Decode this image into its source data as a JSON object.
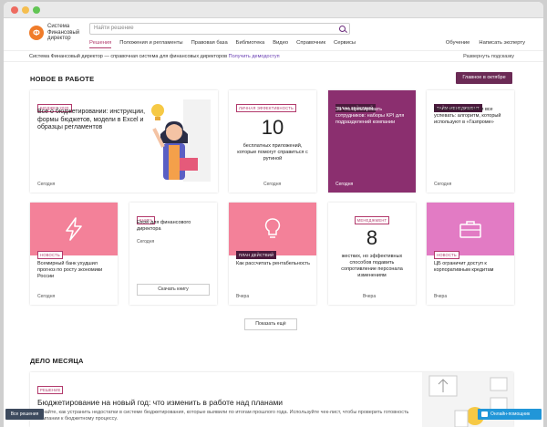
{
  "header": {
    "logo_mark": "Ф",
    "logo_text": "Система Финансовый директор",
    "search_placeholder": "Найти решение",
    "nav": [
      "Решения",
      "Положения и регламенты",
      "Правовая база",
      "Библиотека",
      "Видео",
      "Справочник",
      "Сервисы"
    ],
    "nav_right": [
      "Обучение",
      "Написать эксперту"
    ]
  },
  "subbar": {
    "text": "Система Финансовый директор — справочная система для финансовых директоров",
    "link": "Получить демодоступ",
    "hint": "Развернуть подсказку"
  },
  "section1": {
    "title": "НОВОЕ В РАБОТЕ",
    "main_button": "Главное в октябре"
  },
  "cards_row1": [
    {
      "tag": "БЮДЖЕТ 2020",
      "title": "Все о бюджетировании: инструкции, формы бюджетов, модели в Excel и образцы регламентов",
      "date": "Сегодня"
    },
    {
      "tag": "ЛИЧНАЯ ЭФФЕКТИВНОСТЬ",
      "number": "10",
      "title": "бесплатных приложений, которые помогут справиться с рутиной",
      "date": "Сегодня"
    },
    {
      "tag": "ПЛАН ДЕЙСТВИЙ",
      "title": "За что премировать сотрудников: наборы KPI для подразделений компании",
      "date": "Сегодня"
    },
    {
      "tag": "ТАЙМ-МЕНЕДЖМЕНТ",
      "title": "Как работать вполе и все успевать: алгоритм, который используют в «Газпроме»",
      "date": "Сегодня"
    }
  ],
  "cards_row2": [
    {
      "tag": "НОВОСТЬ",
      "title": "Всемирный банк ухудшил прогноз по росту экономики России",
      "date": "Сегодня"
    },
    {
      "tag": "КНИГА",
      "title": "Excel для финансового директора",
      "date": "Сегодня",
      "button": "Скачать книгу"
    },
    {
      "tag": "ПЛАН ДЕЙСТВИЙ",
      "title": "Как рассчитать рентабельность",
      "date": "Вчера"
    },
    {
      "tag": "МЕНЕДЖМЕНТ",
      "number": "8",
      "title": "жестких, но эффективных способов подавить сопротивление персонала изменениям",
      "date": "Вчера"
    },
    {
      "tag": "НОВОСТЬ",
      "title": "ЦБ ограничит доступ к корпоративным кредитам",
      "date": "Вчера"
    }
  ],
  "more_button": "Показать ещё",
  "section2": {
    "title": "ДЕЛО МЕСЯЦА",
    "tag": "РЕШЕНИЕ",
    "card_title": "Бюджетирование на новый год: что изменить в работе над планами",
    "card_desc": "Узнайте, как устранить недостатки в системе бюджетирования, которые выявили по итогам прошлого года. Используйте чек-лист, чтобы проверить готовность компании к бюджетному процессу."
  },
  "corner_button": "Все решения",
  "chat_button": "Онлайн-помощник",
  "colors": {
    "accent": "#b23a6c",
    "pink": "#f38199",
    "plum": "#8b2f6f",
    "lavender": "#e27bc4",
    "dark_button": "#6b2a55"
  }
}
